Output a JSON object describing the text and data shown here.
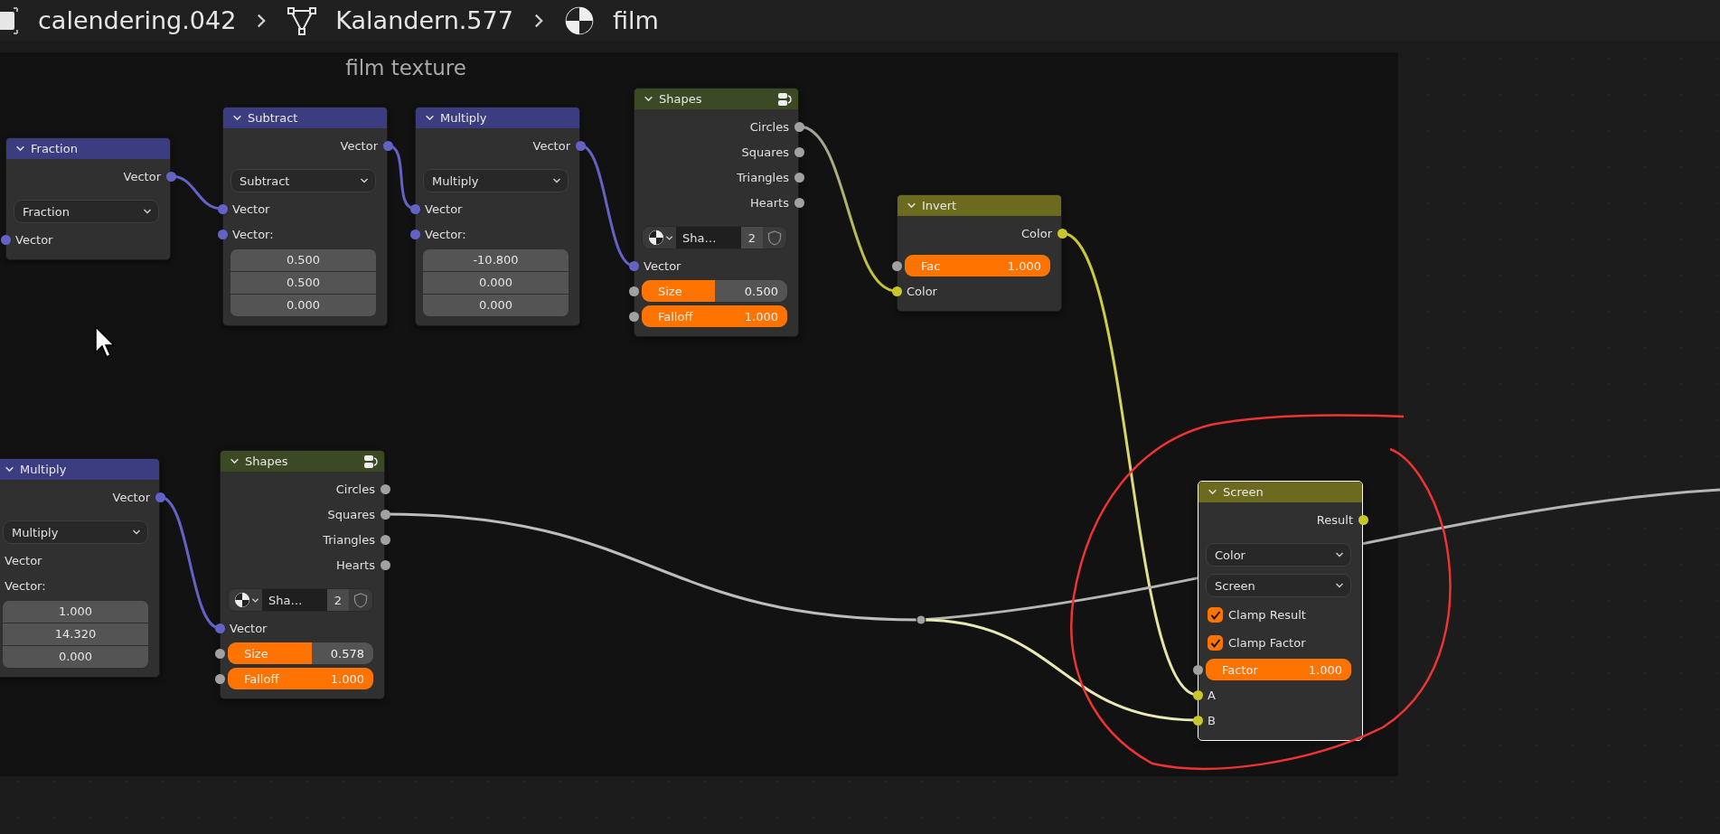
{
  "breadcrumbs": [
    {
      "kind": "object",
      "label": "calendering.042"
    },
    {
      "kind": "mesh",
      "label": "Kalandern.577"
    },
    {
      "kind": "material",
      "label": "film"
    }
  ],
  "frame": {
    "label": "film texture"
  },
  "nodes": [
    {
      "kind": "vector",
      "title": "Fraction",
      "selected": false,
      "rows": [
        {
          "kind": "output",
          "label": "Vector",
          "color": "#6363c7"
        },
        {
          "kind": "select",
          "value": "Fraction"
        },
        {
          "kind": "input",
          "label": "Vector",
          "color": "#6363c7"
        }
      ]
    },
    {
      "kind": "vector",
      "title": "Subtract",
      "selected": false,
      "rows": [
        {
          "kind": "output",
          "label": "Vector",
          "color": "#6363c7"
        },
        {
          "kind": "select",
          "value": "Subtract"
        },
        {
          "kind": "input",
          "label": "Vector",
          "color": "#6363c7"
        },
        {
          "kind": "input",
          "label": "Vector:",
          "color": "#6363c7"
        },
        {
          "kind": "values",
          "values": [
            "0.500",
            "0.500",
            "0.000"
          ]
        }
      ]
    },
    {
      "kind": "vector",
      "title": "Multiply",
      "selected": false,
      "rows": [
        {
          "kind": "output",
          "label": "Vector",
          "color": "#6363c7"
        },
        {
          "kind": "select",
          "value": "Multiply"
        },
        {
          "kind": "input",
          "label": "Vector",
          "color": "#6363c7"
        },
        {
          "kind": "input",
          "label": "Vector:",
          "color": "#6363c7"
        },
        {
          "kind": "values",
          "values": [
            "-10.800",
            "0.000",
            "0.000"
          ]
        }
      ]
    },
    {
      "kind": "texture",
      "title": "Shapes",
      "selected": false,
      "rows": [
        {
          "kind": "output",
          "label": "Circles",
          "color": "#a1a1a1"
        },
        {
          "kind": "output",
          "label": "Squares",
          "color": "#a1a1a1"
        },
        {
          "kind": "output",
          "label": "Triangles",
          "color": "#a1a1a1"
        },
        {
          "kind": "output",
          "label": "Hearts",
          "color": "#a1a1a1"
        },
        {
          "kind": "image",
          "name": "Sha…",
          "users": "2"
        },
        {
          "kind": "input",
          "label": "Vector",
          "color": "#6363c7"
        },
        {
          "kind": "slider",
          "label": "Size",
          "value": "0.500",
          "level": 0.5,
          "color": "#a1a1a1"
        },
        {
          "kind": "slider",
          "label": "Falloff",
          "value": "1.000",
          "level": 1,
          "color": "#a1a1a1"
        }
      ]
    },
    {
      "kind": "color",
      "title": "Invert",
      "selected": false,
      "rows": [
        {
          "kind": "output",
          "label": "Color",
          "color": "#c7c729"
        },
        {
          "kind": "slider",
          "label": "Fac",
          "value": "1.000",
          "level": 1,
          "color": "#a1a1a1"
        },
        {
          "kind": "input",
          "label": "Color",
          "color": "#c7c729"
        }
      ]
    },
    {
      "kind": "vector",
      "title": "Multiply",
      "selected": false,
      "rows": [
        {
          "kind": "output",
          "label": "Vector",
          "color": "#6363c7"
        },
        {
          "kind": "select",
          "value": "Multiply"
        },
        {
          "kind": "label",
          "label": "Vector"
        },
        {
          "kind": "label",
          "label": "Vector:"
        },
        {
          "kind": "values",
          "values": [
            "1.000",
            "14.320",
            "0.000"
          ]
        }
      ]
    },
    {
      "kind": "texture",
      "title": "Shapes",
      "selected": false,
      "rows": [
        {
          "kind": "output",
          "label": "Circles",
          "color": "#a1a1a1"
        },
        {
          "kind": "output",
          "label": "Squares",
          "color": "#a1a1a1"
        },
        {
          "kind": "output",
          "label": "Triangles",
          "color": "#a1a1a1"
        },
        {
          "kind": "output",
          "label": "Hearts",
          "color": "#a1a1a1"
        },
        {
          "kind": "image",
          "name": "Sha…",
          "users": "2"
        },
        {
          "kind": "input",
          "label": "Vector",
          "color": "#6363c7"
        },
        {
          "kind": "slider",
          "label": "Size",
          "value": "0.578",
          "level": 0.578,
          "color": "#a1a1a1"
        },
        {
          "kind": "slider",
          "label": "Falloff",
          "value": "1.000",
          "level": 1,
          "color": "#a1a1a1"
        }
      ]
    },
    {
      "kind": "color",
      "title": "Screen",
      "selected": true,
      "rows": [
        {
          "kind": "output",
          "label": "Result",
          "color": "#c7c729"
        },
        {
          "kind": "select",
          "value": "Color"
        },
        {
          "kind": "select",
          "value": "Screen"
        },
        {
          "kind": "checkbox",
          "label": "Clamp Result",
          "checked": true
        },
        {
          "kind": "checkbox",
          "label": "Clamp Factor",
          "checked": true
        },
        {
          "kind": "slider",
          "label": "Factor",
          "value": "1.000",
          "level": 1,
          "color": "#a1a1a1"
        },
        {
          "kind": "input",
          "label": "A",
          "color": "#c7c729"
        },
        {
          "kind": "input",
          "label": "B",
          "color": "#c7c729"
        }
      ]
    }
  ]
}
